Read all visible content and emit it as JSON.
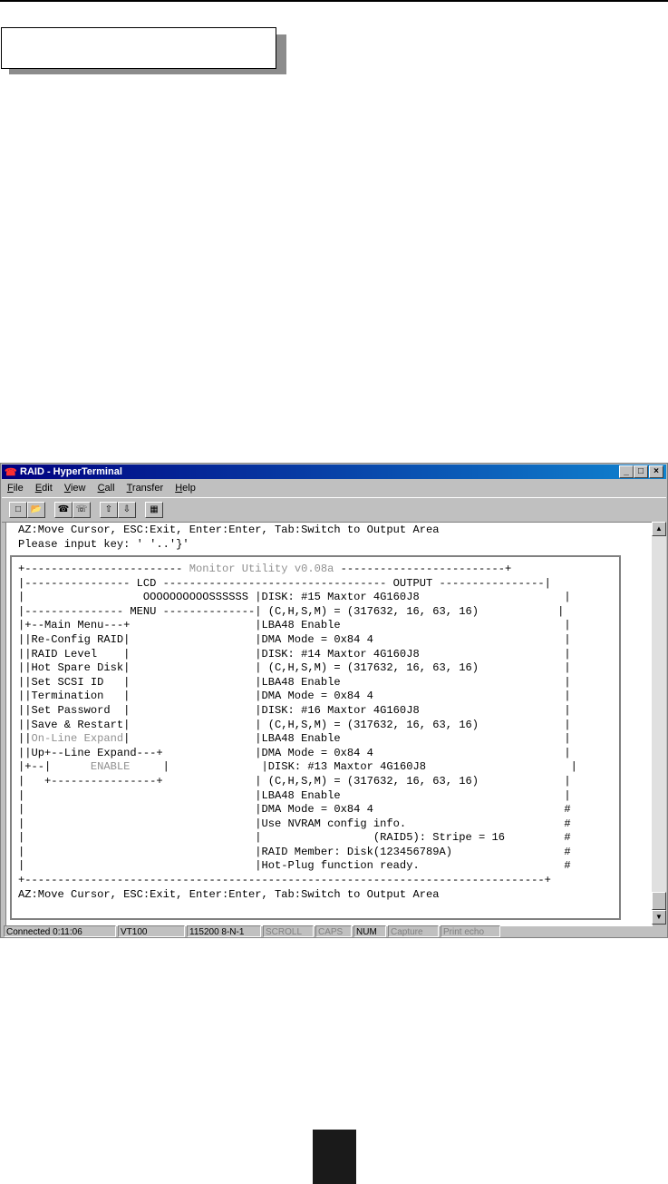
{
  "window": {
    "title": "RAID - HyperTerminal",
    "controls": [
      "_",
      "□",
      "×"
    ]
  },
  "menu": {
    "items": [
      {
        "accel": "F",
        "rest": "ile"
      },
      {
        "accel": "E",
        "rest": "dit"
      },
      {
        "accel": "V",
        "rest": "iew"
      },
      {
        "accel": "C",
        "rest": "all"
      },
      {
        "accel": "T",
        "rest": "ransfer"
      },
      {
        "accel": "H",
        "rest": "elp"
      }
    ]
  },
  "terminal": {
    "header_lines": [
      "AZ:Move Cursor, ESC:Exit, Enter:Enter, Tab:Switch to Output Area",
      "Please input key: ' '..'}'"
    ],
    "screen": {
      "top_border_left": "+------------------------",
      "title": "Monitor Utility v0.08a",
      "top_border_right": "-------------------------+",
      "rows": [
        {
          "left": "|---------------- LCD ---------------------------------- OUTPUT ----------------|",
          "gray_spans": []
        },
        {
          "left": "|                  OOOOOOOOOOSSSSSS |DISK: #15 Maxtor 4G160J8                      |"
        },
        {
          "left": "|--------------- MENU --------------| (C,H,S,M) = (317632, 16, 63, 16)            |"
        },
        {
          "left": "|+--Main Menu---+                   |LBA48 Enable                                  |"
        },
        {
          "left": "||Re-Config RAID|                   |DMA Mode = 0x84 4                             |"
        },
        {
          "left": "||RAID Level    |                   |DISK: #14 Maxtor 4G160J8                      |"
        },
        {
          "left": "||Hot Spare Disk|                   | (C,H,S,M) = (317632, 16, 63, 16)             |"
        },
        {
          "left": "||Set SCSI ID   |                   |LBA48 Enable                                  |"
        },
        {
          "left": "||Termination   |                   |DMA Mode = 0x84 4                             |"
        },
        {
          "left": "||Set Password  |                   |DISK: #16 Maxtor 4G160J8                      |"
        },
        {
          "left": "||Save & Restart|                   | (C,H,S,M) = (317632, 16, 63, 16)             |"
        },
        {
          "left": "||On-Line Expand|                   |LBA48 Enable                                  |",
          "gray": "On-Line Expand"
        },
        {
          "left": "||Up+--Line Expand---+              |DMA Mode = 0x84 4                             |"
        },
        {
          "left": "|+--|      ENABLE     |              |DISK: #13 Maxtor 4G160J8                      |",
          "gray": "ENABLE"
        },
        {
          "left": "|   +----------------+              | (C,H,S,M) = (317632, 16, 63, 16)             |"
        },
        {
          "left": "|                                   |LBA48 Enable                                  |"
        },
        {
          "left": "|                                   |DMA Mode = 0x84 4                             #"
        },
        {
          "left": "|                                   |Use NVRAM config info.                        #"
        },
        {
          "left": "|                                   |                 (RAID5): Stripe = 16         #"
        },
        {
          "left": "|                                   |RAID Member: Disk(123456789A)                 #"
        },
        {
          "left": "|                                   |Hot-Plug function ready.                      #"
        }
      ],
      "bottom_border": "+-------------------------------------------------------------------------------+",
      "footer": "AZ:Move Cursor, ESC:Exit, Enter:Enter, Tab:Switch to Output Area"
    }
  },
  "statusbar": {
    "cells": [
      {
        "text": "Connected 0:11:06",
        "dim": false
      },
      {
        "text": "VT100",
        "dim": false
      },
      {
        "text": "115200 8-N-1",
        "dim": false
      },
      {
        "text": "SCROLL",
        "dim": true
      },
      {
        "text": "CAPS",
        "dim": true
      },
      {
        "text": "NUM",
        "dim": false
      },
      {
        "text": "Capture",
        "dim": true
      },
      {
        "text": "Print echo",
        "dim": true
      }
    ]
  },
  "icons": {
    "toolbar": [
      "new-icon",
      "open-icon",
      "connect-icon",
      "disconnect-icon",
      "send-icon",
      "receive-icon",
      "properties-icon"
    ]
  }
}
